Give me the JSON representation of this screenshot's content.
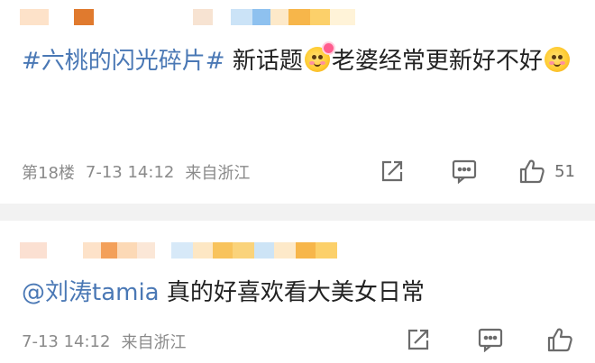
{
  "comments": [
    {
      "topic": "#六桃的闪光碎片#",
      "text_a": " 新话题",
      "text_b": "老婆经常更新好不好",
      "floor": "第18楼",
      "date": "7-13 14:12",
      "source": "来自浙江",
      "likes": "51"
    },
    {
      "mention": "@刘涛tamia",
      "text": " 真的好喜欢看大美女日常",
      "date": "7-13 14:12",
      "source": "来自浙江"
    }
  ],
  "icons": [
    "share-icon",
    "comment-icon",
    "like-icon",
    "smiley-emoji-icon"
  ],
  "colors": {
    "link": "#4a78b5",
    "meta": "#8a8a8a",
    "separator": "#f2f2f2"
  }
}
